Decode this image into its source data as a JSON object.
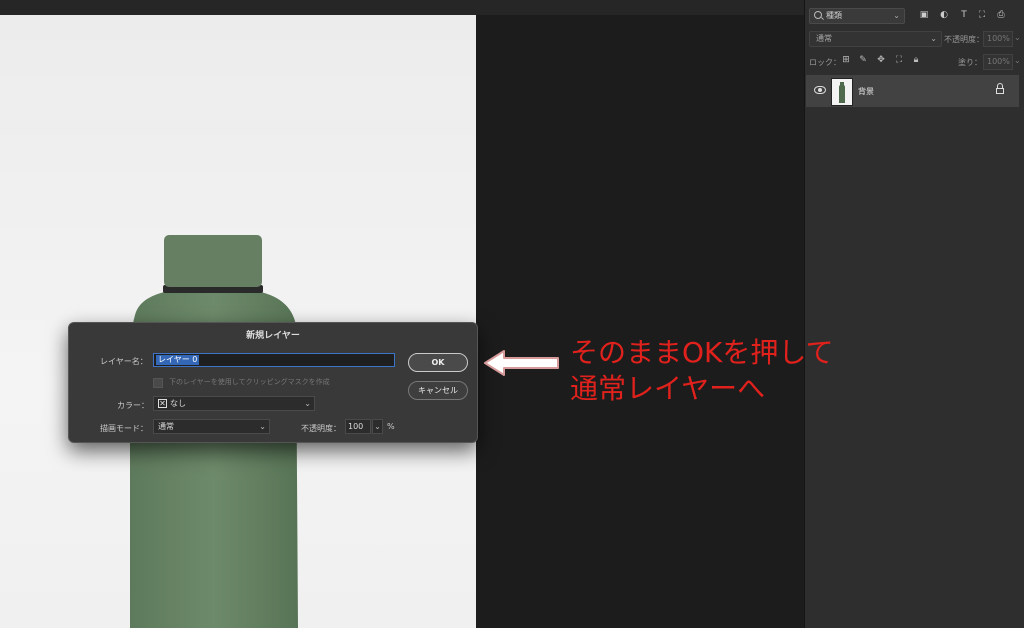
{
  "panel": {
    "kind_filter": "種類",
    "blend_mode": "通常",
    "opacity_label": "不透明度：",
    "opacity_value": "100%",
    "lock_label": "ロック：",
    "fill_label": "塗り：",
    "fill_value": "100%",
    "layer": {
      "name": "背景"
    }
  },
  "dialog": {
    "title": "新規レイヤー",
    "name_label": "レイヤー名：",
    "name_value": "レイヤー 0",
    "clip_label": "下のレイヤーを使用してクリッピングマスクを作成",
    "color_label": "カラー：",
    "color_value": "なし",
    "mode_label": "描画モード：",
    "mode_value": "通常",
    "opacity_label": "不透明度：",
    "opacity_value": "100",
    "percent": "%",
    "ok_label": "OK",
    "cancel_label": "キャンセル"
  },
  "annotation": {
    "line1": "そのままOKを押して",
    "line2": "通常レイヤーへ",
    "color": "#e0211c"
  }
}
